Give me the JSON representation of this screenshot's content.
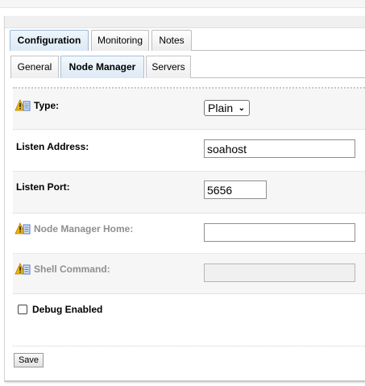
{
  "tabs": {
    "main": [
      "Configuration",
      "Monitoring",
      "Notes"
    ],
    "sub": [
      "General",
      "Node Manager",
      "Servers"
    ],
    "active_main": "Configuration",
    "active_sub": "Node Manager"
  },
  "form": {
    "type": {
      "label": "Type:",
      "value": "Plain",
      "icon": "warning-settings-icon"
    },
    "listen_address": {
      "label": "Listen Address:",
      "value": "soahost"
    },
    "listen_port": {
      "label": "Listen Port:",
      "value": "5656"
    },
    "node_manager_home": {
      "label": "Node Manager Home:",
      "value": "",
      "disabled": true,
      "icon": "warning-settings-icon"
    },
    "shell_command": {
      "label": "Shell Command:",
      "value": "",
      "disabled": true,
      "icon": "warning-settings-icon"
    },
    "debug_enabled": {
      "label": "Debug Enabled",
      "checked": false
    }
  },
  "actions": {
    "save_label": "Save"
  },
  "colors": {
    "active_tab": "#dce9f6",
    "disabled_text": "#8f8f8f",
    "row_alt": "#f6f6f6",
    "warning_icon": "#f0b400"
  }
}
